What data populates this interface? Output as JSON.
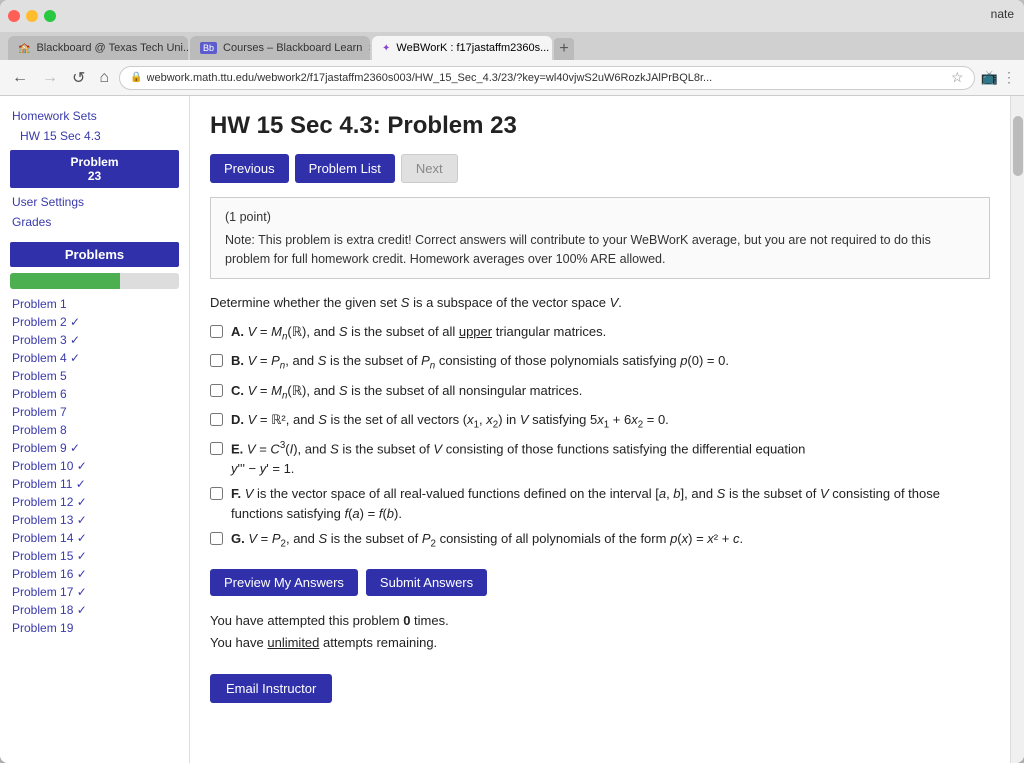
{
  "browser": {
    "tabs": [
      {
        "label": "Blackboard @ Texas Tech Uni...",
        "icon": "🏫",
        "active": false
      },
      {
        "label": "Courses – Blackboard Learn",
        "icon": "Bb",
        "active": false
      },
      {
        "label": "WeBWorK : f17jastaffm2360s...",
        "icon": "✦",
        "active": true
      }
    ],
    "user_label": "nate",
    "address": "webwork.math.ttu.edu/webwork2/f17jastaffm2360s003/HW_15_Sec_4.3/23/?key=wl40vjwS2uW6RozkJAlPrBQL8r...",
    "back_btn": "←",
    "forward_btn": "→",
    "refresh_btn": "↺",
    "home_btn": "⌂"
  },
  "sidebar": {
    "homework_sets_label": "Homework Sets",
    "hw_link": "HW 15 Sec 4.3",
    "current_problem_label": "Problem\n23",
    "user_settings_label": "User Settings",
    "grades_label": "Grades",
    "problems_header": "Problems",
    "progress_pct": 65,
    "problem_items": [
      {
        "label": "Problem 1",
        "check": false
      },
      {
        "label": "Problem 2 ✓",
        "check": true
      },
      {
        "label": "Problem 3 ✓",
        "check": true
      },
      {
        "label": "Problem 4 ✓",
        "check": true
      },
      {
        "label": "Problem 5",
        "check": false
      },
      {
        "label": "Problem 6",
        "check": false
      },
      {
        "label": "Problem 7",
        "check": false
      },
      {
        "label": "Problem 8",
        "check": false
      },
      {
        "label": "Problem 9 ✓",
        "check": true
      },
      {
        "label": "Problem 10 ✓",
        "check": true
      },
      {
        "label": "Problem 11 ✓",
        "check": true
      },
      {
        "label": "Problem 12 ✓",
        "check": true
      },
      {
        "label": "Problem 13 ✓",
        "check": true
      },
      {
        "label": "Problem 14 ✓",
        "check": true
      },
      {
        "label": "Problem 15 ✓",
        "check": true
      },
      {
        "label": "Problem 16 ✓",
        "check": true
      },
      {
        "label": "Problem 17 ✓",
        "check": true
      },
      {
        "label": "Problem 18 ✓",
        "check": true
      },
      {
        "label": "Problem 19",
        "check": false
      }
    ]
  },
  "page": {
    "title": "HW 15 Sec 4.3: Problem 23",
    "prev_btn": "Previous",
    "problem_list_btn": "Problem List",
    "next_btn": "Next",
    "points": "(1 point)",
    "note": "Note: This problem is extra credit! Correct answers will contribute to your WeBWorK average, but you are not required to do this problem for full homework credit. Homework averages over 100% ARE allowed.",
    "question": "Determine whether the given set S is a subspace of the vector space V.",
    "options": [
      {
        "id": "A",
        "text": "A. V = Mₙ(ℝ), and S is the subset of all upper triangular matrices."
      },
      {
        "id": "B",
        "text": "B. V = Pₙ, and S is the subset of Pₙ consisting of those polynomials satisfying p(0) = 0."
      },
      {
        "id": "C",
        "text": "C. V = Mₙ(ℝ), and S is the subset of all nonsingular matrices."
      },
      {
        "id": "D",
        "text": "D. V = ℝ², and S is the set of all vectors (x₁, x₂) in V satisfying 5x₁ + 6x₂ = 0."
      },
      {
        "id": "E",
        "text": "E. V = C³(I), and S is the subset of V consisting of those functions satisfying the differential equation y''' − y' = 1."
      },
      {
        "id": "F",
        "text": "F. V is the vector space of all real-valued functions defined on the interval [a, b], and S is the subset of V consisting of those functions satisfying f(a) = f(b)."
      },
      {
        "id": "G",
        "text": "G. V = P₂, and S is the subset of P₂ consisting of all polynomials of the form p(x) = x² + c."
      }
    ],
    "preview_btn": "Preview My Answers",
    "submit_btn": "Submit Answers",
    "attempts_text": "You have attempted this problem 0 times.",
    "remaining_text": "You have unlimited attempts remaining.",
    "email_btn": "Email Instructor"
  }
}
